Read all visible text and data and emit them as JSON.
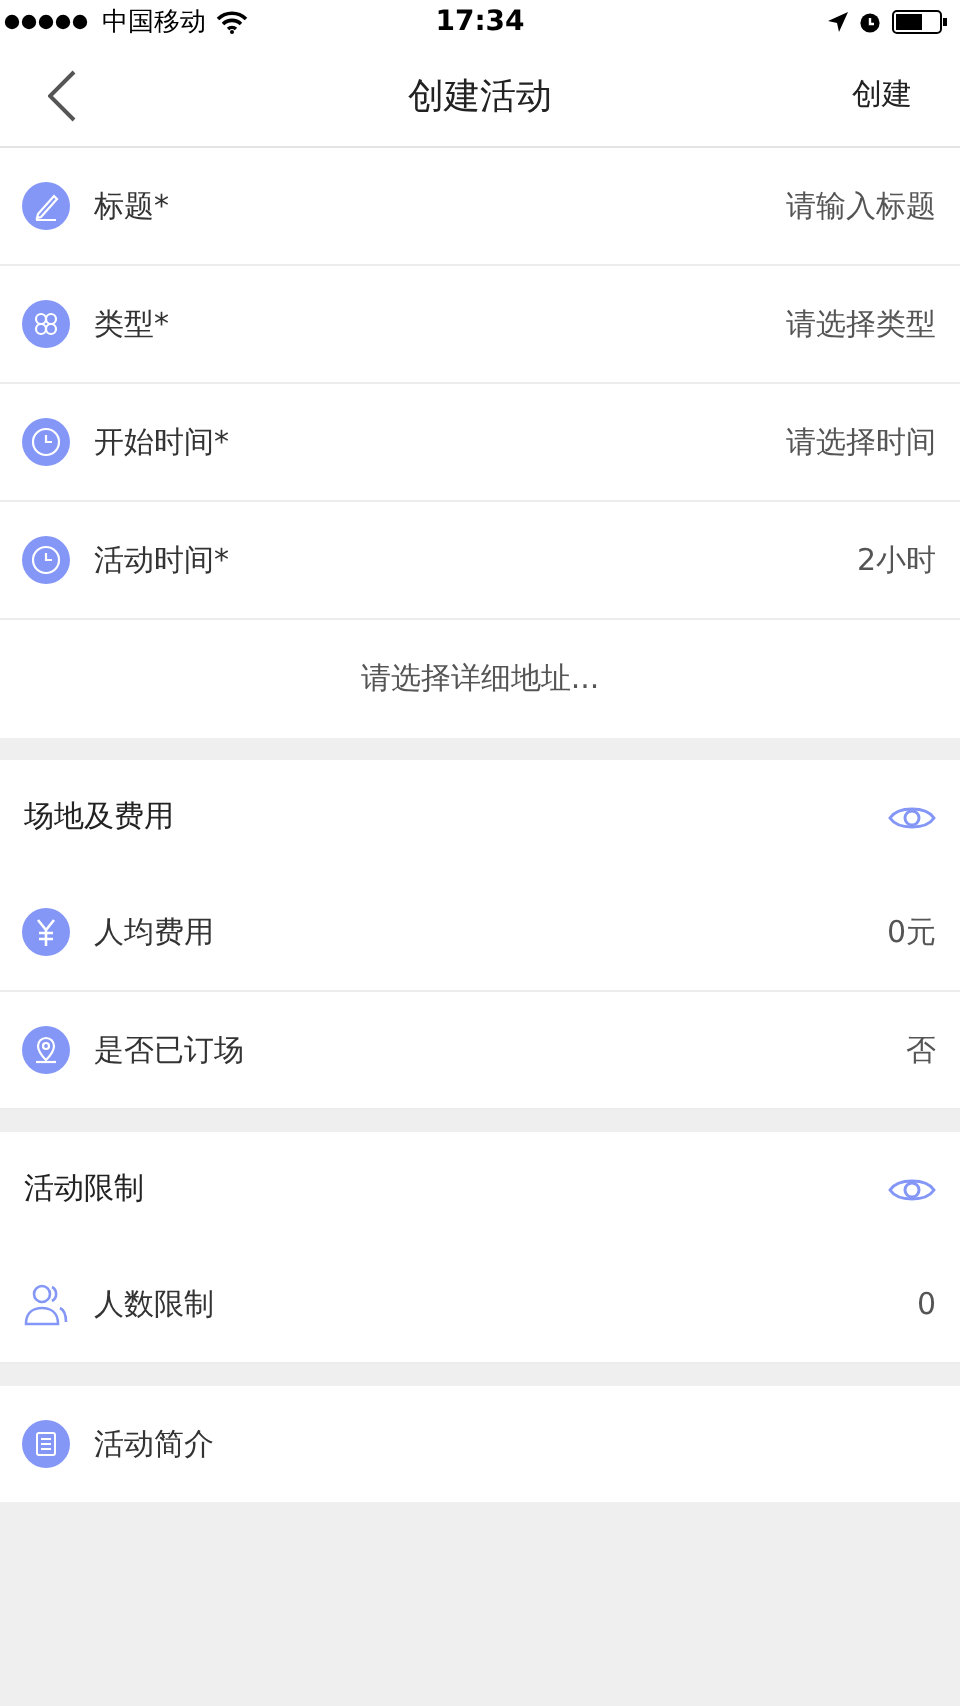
{
  "status_bar": {
    "carrier": "中国移动",
    "time": "17:34"
  },
  "nav": {
    "title": "创建活动",
    "action": "创建"
  },
  "basic_fields": [
    {
      "kind": "pen",
      "label": "标题*",
      "value": "请输入标题"
    },
    {
      "kind": "clover",
      "label": "类型*",
      "value": "请选择类型"
    },
    {
      "kind": "clock",
      "label": "开始时间*",
      "value": "请选择时间"
    },
    {
      "kind": "clock",
      "label": "活动时间*",
      "value": "2小时"
    }
  ],
  "address": {
    "value": "请选择详细地址..."
  },
  "sections": [
    {
      "title": "场地及费用",
      "fields": [
        {
          "kind": "yen",
          "label": "人均费用",
          "value": "0元"
        },
        {
          "kind": "pin",
          "label": "是否已订场",
          "value": "否"
        }
      ]
    },
    {
      "title": "活动限制",
      "fields": [
        {
          "kind": "people",
          "label": "人数限制",
          "value": "0"
        }
      ]
    }
  ],
  "intro": {
    "kind": "note",
    "label": "活动简介"
  }
}
